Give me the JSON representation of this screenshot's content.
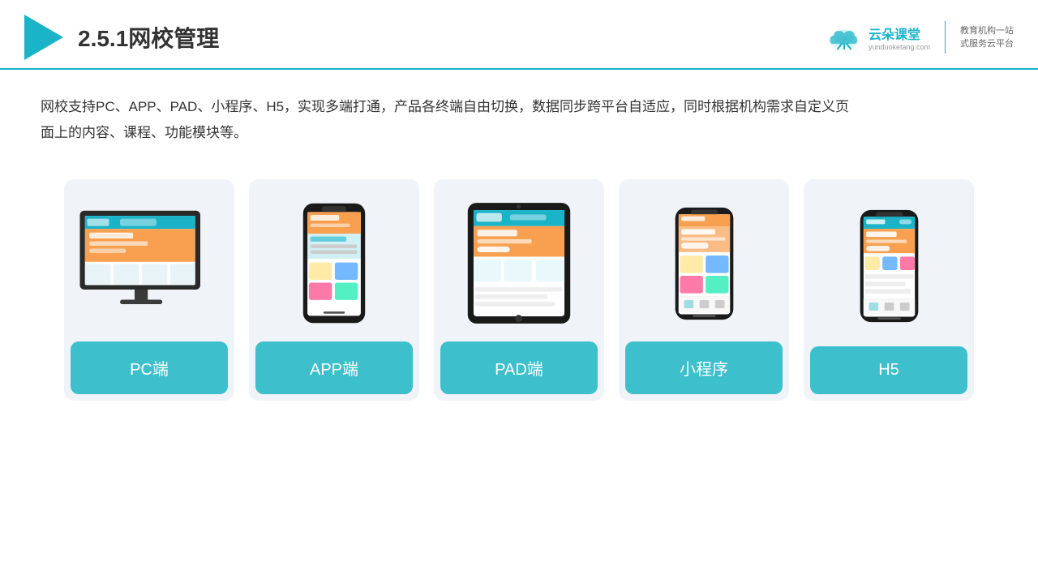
{
  "header": {
    "title": "2.5.1网校管理",
    "logo_main": "云朵课堂",
    "logo_sub": "yunduoketang.com",
    "platform_line1": "教育机构一站",
    "platform_line2": "式服务云平台"
  },
  "description": {
    "text": "网校支持PC、APP、PAD、小程序、H5，实现多端打通，产品各终端自由切换，数据同步跨平台自适应，同时根据机构需求自定义页面上的内容、课程、功能模块等。"
  },
  "cards": [
    {
      "id": "pc",
      "label": "PC端",
      "device": "pc"
    },
    {
      "id": "app",
      "label": "APP端",
      "device": "phone"
    },
    {
      "id": "pad",
      "label": "PAD端",
      "device": "tablet"
    },
    {
      "id": "mini",
      "label": "小程序",
      "device": "phone-mini"
    },
    {
      "id": "h5",
      "label": "H5",
      "device": "phone2"
    }
  ]
}
